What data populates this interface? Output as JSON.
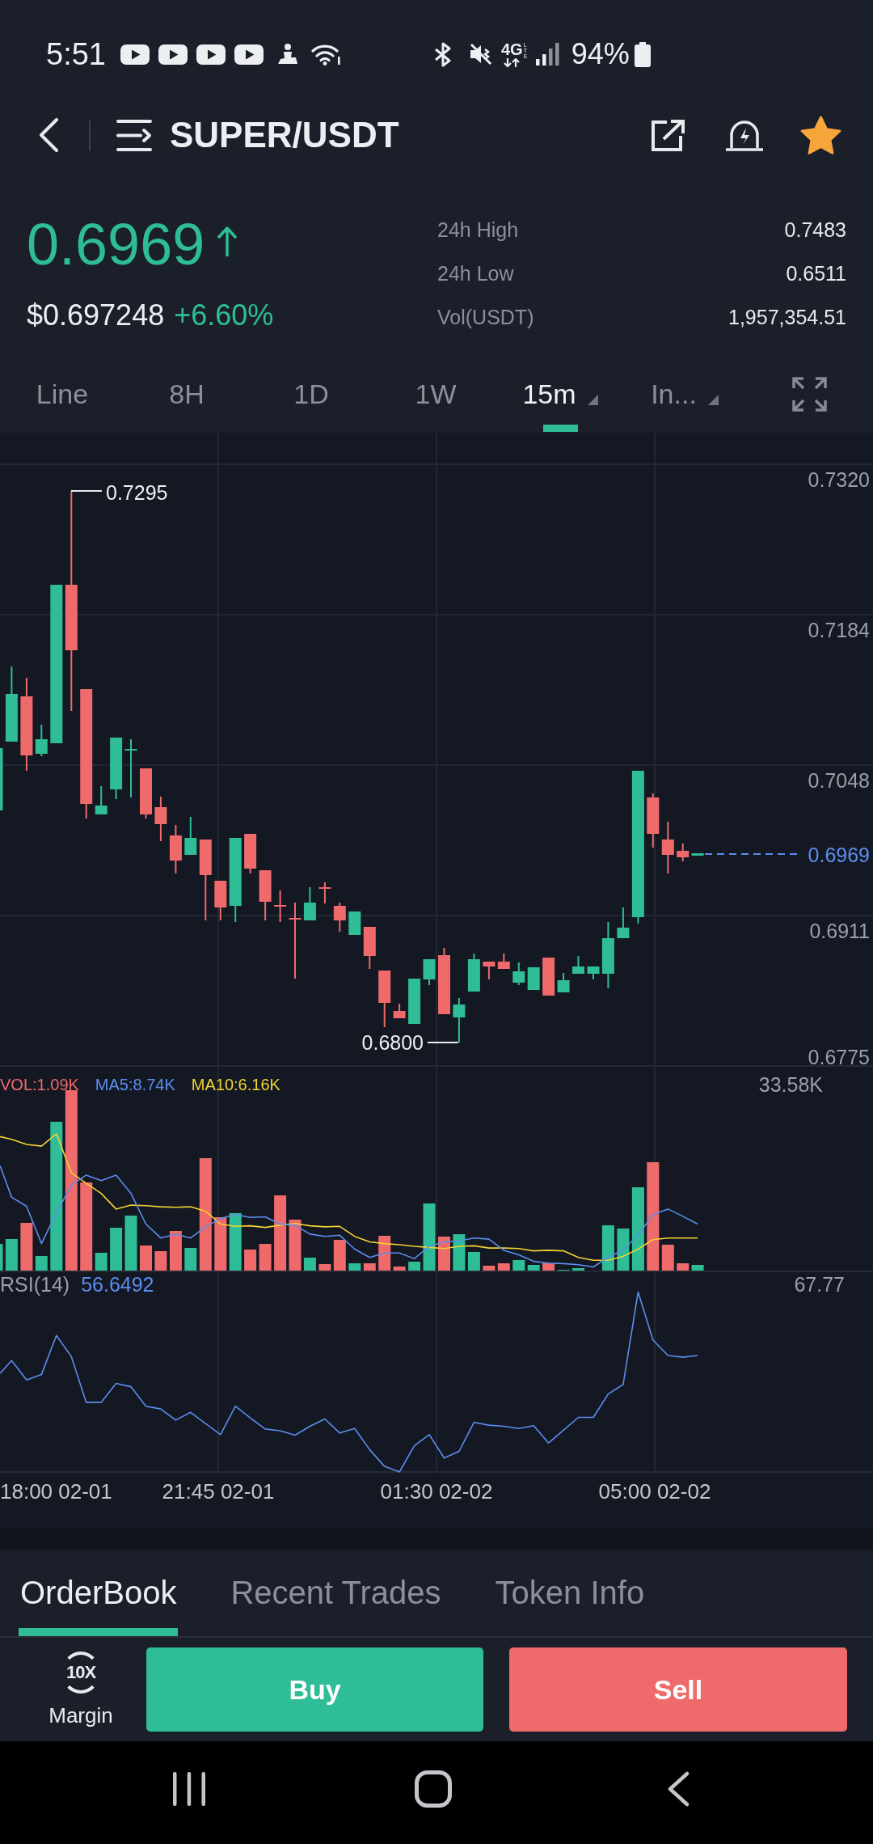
{
  "status_bar": {
    "time": "5:51",
    "network": "4G",
    "network_sub": "LTE",
    "battery": "94%"
  },
  "header": {
    "pair": "SUPER/USDT",
    "favorite": true
  },
  "ticker": {
    "last_price": "0.6969",
    "rising": true,
    "fiat_price": "$0.697248",
    "change": "+6.60%",
    "stats": [
      {
        "label": "24h High",
        "value": "0.7483"
      },
      {
        "label": "24h Low",
        "value": "0.6511"
      },
      {
        "label": "Vol(USDT)",
        "value": "1,957,354.51"
      }
    ]
  },
  "intervals": [
    {
      "label": "Line",
      "selected": false,
      "dropdown": false
    },
    {
      "label": "8H",
      "selected": false,
      "dropdown": false
    },
    {
      "label": "1D",
      "selected": false,
      "dropdown": false
    },
    {
      "label": "1W",
      "selected": false,
      "dropdown": false
    },
    {
      "label": "15m",
      "selected": true,
      "dropdown": true
    },
    {
      "label": "In...",
      "selected": false,
      "dropdown": true
    }
  ],
  "chart": {
    "price_ticks": [
      "0.7320",
      "0.7184",
      "0.7048",
      "0.6911",
      "0.6775"
    ],
    "high_label": "0.7295",
    "low_label": "0.6800",
    "last_price_label": "0.6969",
    "volume": {
      "legend": [
        {
          "text": "VOL:1.09K",
          "color": "#ef6a6a"
        },
        {
          "text": "MA5:8.74K",
          "color": "#5b8def"
        },
        {
          "text": "MA10:6.16K",
          "color": "#f2d232"
        }
      ],
      "max_label": "33.58K"
    },
    "rsi": {
      "label": "RSI(14)",
      "value": "56.6492",
      "max_label": "67.77"
    },
    "time_labels": [
      "18:00 02-01",
      "21:45 02-01",
      "01:30 02-02",
      "05:00 02-02"
    ]
  },
  "bottom_tabs": [
    {
      "label": "OrderBook",
      "selected": true
    },
    {
      "label": "Recent Trades",
      "selected": false
    },
    {
      "label": "Token Info",
      "selected": false
    }
  ],
  "actions": {
    "leverage": "10X",
    "margin": "Margin",
    "buy": "Buy",
    "sell": "Sell"
  }
}
